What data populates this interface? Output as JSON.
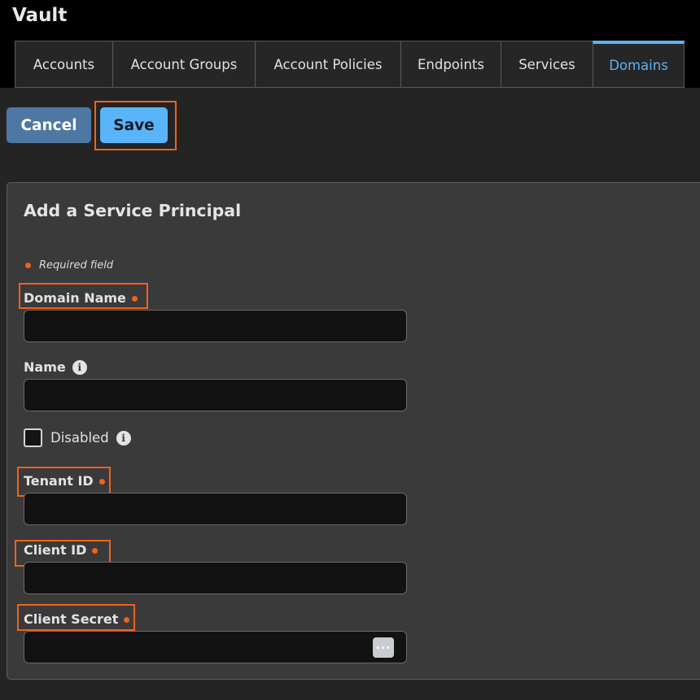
{
  "app": {
    "title": "Vault"
  },
  "tabs": [
    {
      "label": "Accounts",
      "active": false
    },
    {
      "label": "Account Groups",
      "active": false
    },
    {
      "label": "Account Policies",
      "active": false
    },
    {
      "label": "Endpoints",
      "active": false
    },
    {
      "label": "Services",
      "active": false
    },
    {
      "label": "Domains",
      "active": true
    }
  ],
  "toolbar": {
    "cancel_label": "Cancel",
    "save_label": "Save"
  },
  "form": {
    "title": "Add a Service Principal",
    "required_note": "Required field",
    "fields": {
      "domain_name": {
        "label": "Domain Name",
        "value": "",
        "required": true
      },
      "name": {
        "label": "Name",
        "value": "",
        "required": false
      },
      "tenant_id": {
        "label": "Tenant ID",
        "value": "",
        "required": true
      },
      "client_id": {
        "label": "Client ID",
        "value": "",
        "required": true
      },
      "client_secret": {
        "label": "Client Secret",
        "value": "",
        "required": true
      }
    },
    "disabled": {
      "label": "Disabled",
      "checked": false
    }
  },
  "icons": {
    "info": "info-icon",
    "more": "ellipsis-icon",
    "required": "required-dot"
  },
  "colors": {
    "accent": "#5cb2f5",
    "highlight": "#f0621d",
    "cancel_button": "#4f77a4",
    "save_button": "#5ab4f9"
  }
}
